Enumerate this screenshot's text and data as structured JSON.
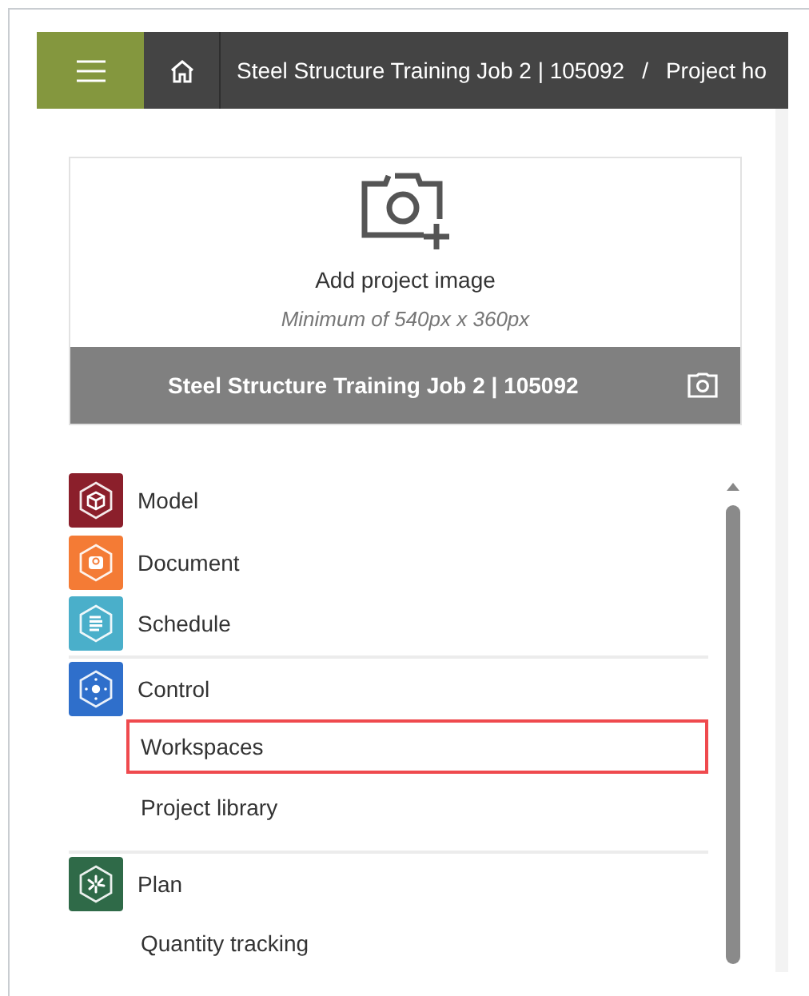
{
  "header": {
    "breadcrumb": [
      "Steel Structure Training Job 2 | 105092",
      "/",
      "Project ho"
    ]
  },
  "project_card": {
    "upload_label": "Add project image",
    "upload_hint": "Minimum of 540px x 360px",
    "project_name": "Steel Structure Training Job 2 | 105092"
  },
  "nav_groups": [
    {
      "apps": [
        {
          "label": "Model",
          "kind": "model",
          "color": "#8b1f2b"
        },
        {
          "label": "Document",
          "kind": "document",
          "color": "#f47b35"
        },
        {
          "label": "Schedule",
          "kind": "schedule",
          "color": "#4aafca"
        }
      ]
    },
    {
      "apps": [
        {
          "label": "Control",
          "kind": "control",
          "color": "#2f6fcb",
          "children": [
            {
              "label": "Workspaces",
              "selected": true
            },
            {
              "label": "Project library",
              "selected": false
            }
          ]
        }
      ]
    },
    {
      "apps": [
        {
          "label": "Plan",
          "kind": "plan",
          "color": "#2f6a48",
          "children": [
            {
              "label": "Quantity tracking",
              "selected": false
            }
          ]
        }
      ]
    }
  ]
}
